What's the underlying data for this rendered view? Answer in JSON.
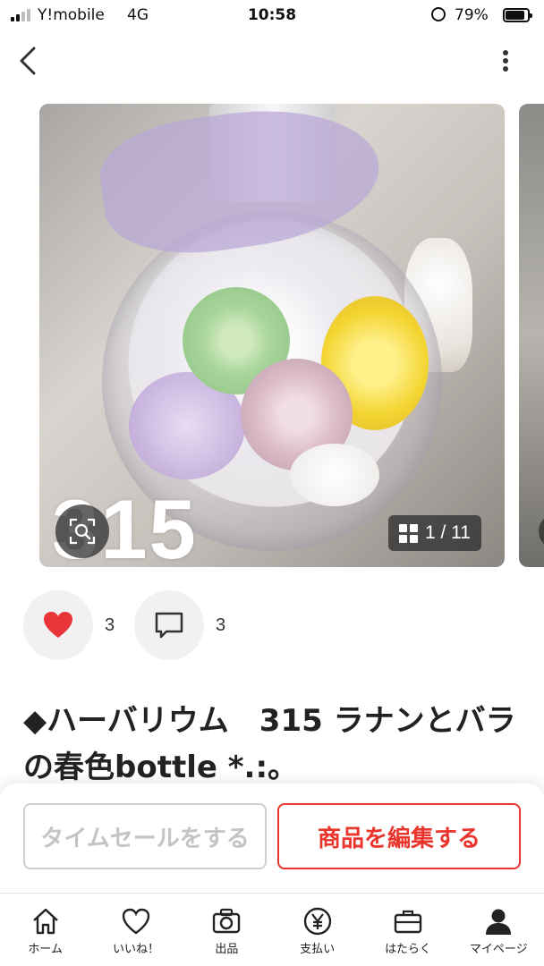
{
  "status_bar": {
    "carrier": "Y!mobile",
    "network": "4G",
    "time": "10:58",
    "battery_percent": "79%",
    "icons": [
      "signal-icon",
      "rotation-lock-icon",
      "battery-icon"
    ]
  },
  "nav": {
    "icons": [
      "back-arrow-icon",
      "more-vertical-icon"
    ]
  },
  "carousel": {
    "watermark": "315",
    "counter": "1 / 11",
    "icons": [
      "zoom-icon",
      "grid-icon"
    ]
  },
  "social": {
    "likes": "3",
    "comments": "3",
    "like_color": "#e8353a",
    "icons": [
      "heart-icon",
      "comment-icon"
    ]
  },
  "item": {
    "title": "◆ハーバリウム　315 ラナンとバラの春色bottle *.:。"
  },
  "actions": {
    "time_sale_label": "タイムセールをする",
    "edit_label": "商品を編集する",
    "accent_color": "#ea352d"
  },
  "tabs": [
    {
      "label": "ホーム",
      "icon": "home-icon"
    },
    {
      "label": "いいね！",
      "icon": "heart-icon"
    },
    {
      "label": "出品",
      "icon": "camera-icon"
    },
    {
      "label": "支払い",
      "icon": "yen-icon"
    },
    {
      "label": "はたらく",
      "icon": "briefcase-icon"
    },
    {
      "label": "マイページ",
      "icon": "user-icon"
    }
  ]
}
